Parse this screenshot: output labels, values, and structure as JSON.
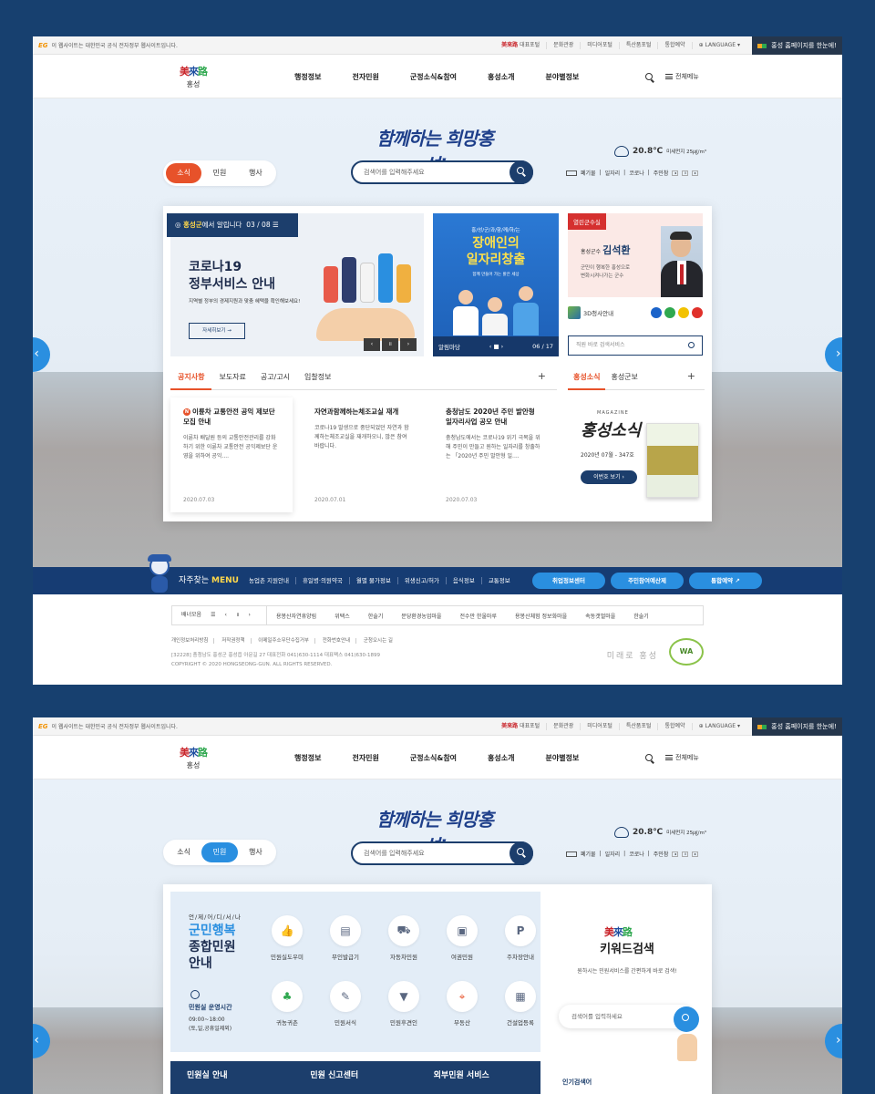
{
  "topbar": {
    "notice_logo": "EG",
    "notice": "이 웹사이트는 대한민국 공식 전자정부 웹사이트입니다.",
    "links": [
      "대표포털",
      "문화관광",
      "미디어포털",
      "특산품포털",
      "통합예약"
    ],
    "language": "LANGUAGE",
    "korean_btn": "홍성 홈페이지를 한눈에!"
  },
  "header": {
    "logo_mark": "美來路",
    "logo_sub": "홍성",
    "nav": [
      "행정정보",
      "전자민원",
      "군정소식&참여",
      "홍성소개",
      "분야별정보"
    ],
    "all_menu": "전체메뉴"
  },
  "hero": {
    "slogan": "함께하는 희망홍성!",
    "search_placeholder": "검색어를 입력해주세요",
    "weather_temp": "20.8℃",
    "weather_detail": "미세먼지 25㎍/m³",
    "news_items": [
      "폐기물",
      "일자리",
      "코로나",
      "주민참"
    ],
    "tabs": [
      "소식",
      "민원",
      "행사"
    ]
  },
  "notice_banner": {
    "badge_org": "홍성군",
    "badge_rest": "에서 알립니다",
    "counter": "03 / 08",
    "title_l1": "코로나19",
    "title_l2": "정부서비스 안내",
    "subtitle": "지역별 정부의 경제지원과 맞춤 혜택을 확인해보세요!",
    "more": "자세히보기 →"
  },
  "job_banner": {
    "sub": "홍/성/군/과/함/께/하/는",
    "title_l1": "장애인의",
    "title_l2": "일자리창출",
    "tiny": "함께 만들어 가는 밝은 세상",
    "footer_label": "알림마당",
    "counter": "06 / 17"
  },
  "governor": {
    "tag": "열린군수실",
    "role": "홍성군수",
    "name": "김석환",
    "desc_l1": "군민이 행복한 홍성으로",
    "desc_l2": "변화시켜나가는 군수",
    "tour": "3D청사안내",
    "search_placeholder": "직원 바로 검색서비스"
  },
  "news_tabs": [
    "공지사항",
    "보도자료",
    "공고/고시",
    "입찰정보"
  ],
  "news": [
    {
      "title": "이륜차 교통안전 공익 제보단 모집 안내",
      "body": "이륜차 배달원 등의 교통안전관리를 강화하기 위한 이륜차 교통안전 공익제보단 운영을 위하여 공익....",
      "date": "2020.07.03",
      "new": "N"
    },
    {
      "title": "자연과함께하는체조교실 재개",
      "body": "코로나19 발생으로 중단되었던 자연과 함께하는체조교실을 재개하오니, 많은 참여 바랍니다.",
      "date": "2020.07.01"
    },
    {
      "title": "충청남도 2020년 주민 발안형 일자리사업 공모 안내",
      "body": "충청남도에서는 코로나19 위기 극복을 위해 주민이 만들고 원하는 일자리를 창출하는 「2020년 주민 발안형 일....",
      "date": "2020.07.03"
    }
  ],
  "right_tabs": [
    "홍성소식",
    "홍성군보"
  ],
  "magazine": {
    "label": "MAGAZINE",
    "title": "홍성소식",
    "date": "2020년 07월 - 347호",
    "button": "이번호 보기 ›"
  },
  "quick": {
    "title_a": "자주찾는 ",
    "title_b": "MENU",
    "links": [
      "농업촌 지원안내",
      "휴일병·의원약국",
      "월별 물가정보",
      "위생신고/허가",
      "음식정보",
      "교통정보"
    ],
    "buttons": [
      "취업정보센터",
      "주민참여예산제",
      "통합예약 ↗"
    ]
  },
  "banner_row": {
    "label": "배너모음",
    "items": [
      "용봉산자연휴양림",
      "위택스",
      "한술기",
      "문당환경농업마을",
      "전수만 한울마루",
      "용봉산체험 정보화마을",
      "속동갯벌마을",
      "한술기"
    ]
  },
  "footer": {
    "links": [
      "개인정보처리방침",
      "저작권정책",
      "이메일주소무단수집거부",
      "전화번호안내",
      "군청오시는 길"
    ],
    "address": "[32228] 충청남도 홍성군 홍성읍 아문길 27     대표전화 041)630-1114     대표팩스 041)630-1899",
    "copyright": "COPYRIGHT © 2020 HONGSEONG-GUN. ALL RIGHTS RESERVED.",
    "brand": "미래로 홍성",
    "wa": "WA"
  },
  "civil": {
    "sub": "언/제/어/디/서/나",
    "title_l1": "군민행복",
    "title_l2": "종합민원",
    "title_l3": "안내",
    "hours_title": "민원실 운영시간",
    "hours_l1": "09:00~18:00",
    "hours_l2": "(토,일,공휴일제외)",
    "services": [
      "민원실도우미",
      "무인발급기",
      "자동차민원",
      "여권민원",
      "주차장안내",
      "귀농귀촌",
      "민원서식",
      "민원후견인",
      "부동산",
      "건설업등록"
    ],
    "bottom": [
      "민원실 안내",
      "민원 신고센터",
      "외부민원 서비스"
    ]
  },
  "keyword": {
    "logo": "美來路",
    "title": "키워드검색",
    "desc": "원하시는 민원서비스를 간편하게 바로 검색!",
    "placeholder": "검색어를 입력하세요",
    "popular": "인기검색어"
  }
}
